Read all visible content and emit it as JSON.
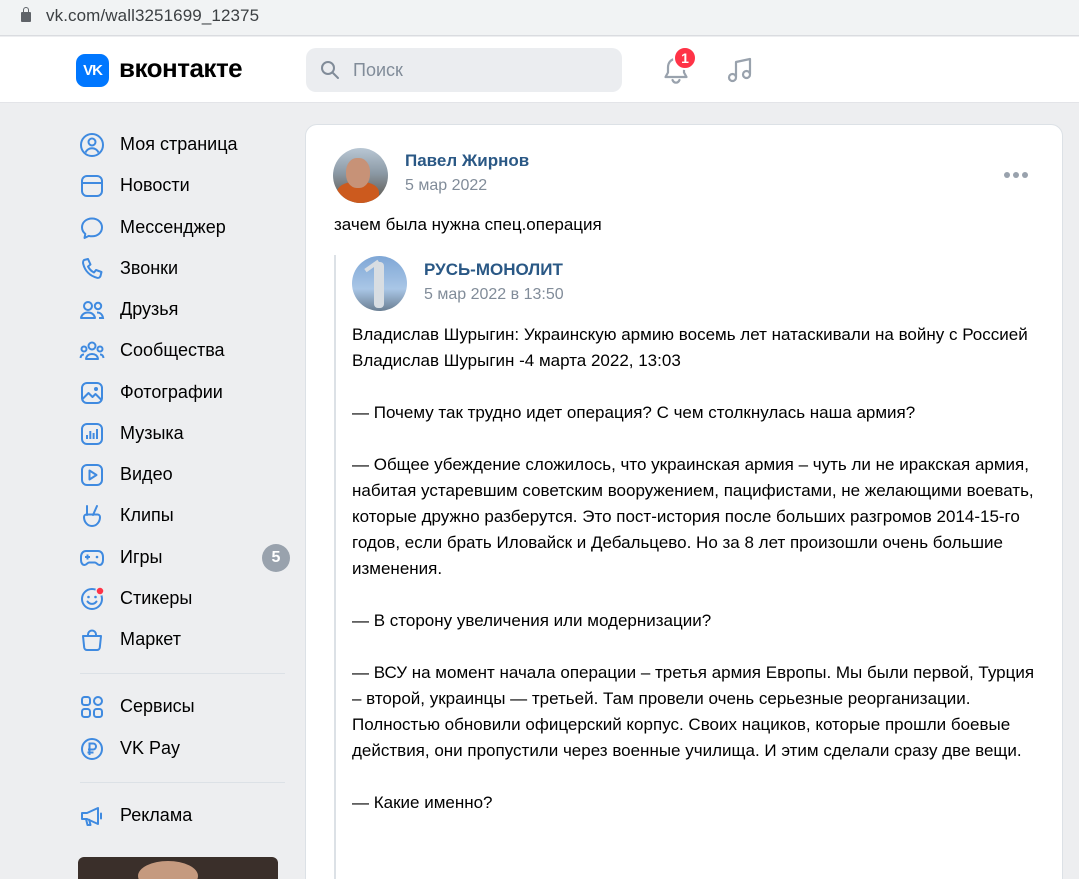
{
  "browser": {
    "url": "vk.com/wall3251699_12375"
  },
  "header": {
    "logo_mark": "VK",
    "logo_text": "вконтакте",
    "search_placeholder": "Поиск",
    "notifications_count": "1"
  },
  "sidebar": {
    "items": [
      {
        "label": "Моя страница",
        "icon": "user-circle-icon"
      },
      {
        "label": "Новости",
        "icon": "news-icon"
      },
      {
        "label": "Мессенджер",
        "icon": "message-icon"
      },
      {
        "label": "Звонки",
        "icon": "phone-icon"
      },
      {
        "label": "Друзья",
        "icon": "friends-icon"
      },
      {
        "label": "Сообщества",
        "icon": "communities-icon"
      },
      {
        "label": "Фотографии",
        "icon": "photo-icon"
      },
      {
        "label": "Музыка",
        "icon": "music-icon"
      },
      {
        "label": "Видео",
        "icon": "video-icon"
      },
      {
        "label": "Клипы",
        "icon": "clips-icon"
      },
      {
        "label": "Игры",
        "icon": "gamepad-icon",
        "badge": "5"
      },
      {
        "label": "Стикеры",
        "icon": "sticker-icon"
      },
      {
        "label": "Маркет",
        "icon": "market-icon"
      }
    ],
    "services": [
      {
        "label": "Сервисы",
        "icon": "grid-icon"
      },
      {
        "label": "VK Pay",
        "icon": "ruble-icon"
      }
    ],
    "ads": {
      "label": "Реклама",
      "icon": "megaphone-icon"
    }
  },
  "post": {
    "author": "Павел Жирнов",
    "date": "5 мар 2022",
    "text": "зачем была нужна спец.операция",
    "repost": {
      "author": "РУСЬ-МОНОЛИТ",
      "date": "5 мар 2022 в 13:50",
      "paragraphs": [
        "Владислав Шурыгин: Украинскую армию восемь лет натаскивали на войну с Россией",
        "Владислав Шурыгин -4 марта 2022, 13:03",
        "",
        "— Почему так трудно идет операция? С чем столкнулась наша армия?",
        "",
        "— Общее убеждение сложилось, что украинская армия – чуть ли не иракская армия, набитая устаревшим советским вооружением, пацифистами, не желающими воевать, которые дружно разберутся. Это пост-история после больших разгромов 2014-15-го годов, если брать Иловайск и Дебальцево. Но за 8 лет произошли очень большие изменения.",
        "",
        "— В сторону увеличения или модернизации?",
        "",
        "— ВСУ на момент начала операции – третья армия Европы. Мы были первой, Турция – второй, украинцы — третьей. Там провели очень серьезные реорганизации. Полностью обновили офицерский корпус. Своих нациков, которые прошли боевые действия, они пропустили через военные училища. И этим сделали сразу две вещи.",
        "",
        "— Какие именно?"
      ]
    }
  },
  "colors": {
    "accent": "#0077ff",
    "link": "#2a5885",
    "muted": "#818c99",
    "badge": "#ff3347"
  }
}
